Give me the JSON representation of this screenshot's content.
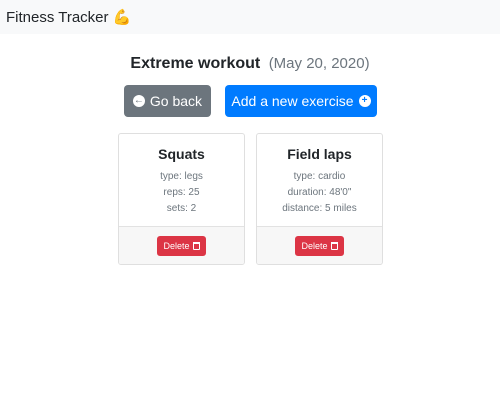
{
  "navbar": {
    "brand": "Fitness Tracker",
    "brand_emoji": "💪"
  },
  "workout": {
    "title": "Extreme workout",
    "date": "(May 20, 2020)"
  },
  "actions": {
    "back_label": "Go back",
    "add_label": "Add a new exercise"
  },
  "exercises": [
    {
      "name": "Squats",
      "lines": [
        "type: legs",
        "reps: 25",
        "sets: 2"
      ],
      "delete_label": "Delete"
    },
    {
      "name": "Field laps",
      "lines": [
        "type: cardio",
        "duration: 48'0\"",
        "distance: 5 miles"
      ],
      "delete_label": "Delete"
    }
  ],
  "colors": {
    "navbar_bg": "#f8f9fa",
    "secondary": "#6c757d",
    "primary": "#007bff",
    "danger": "#dc3545"
  }
}
